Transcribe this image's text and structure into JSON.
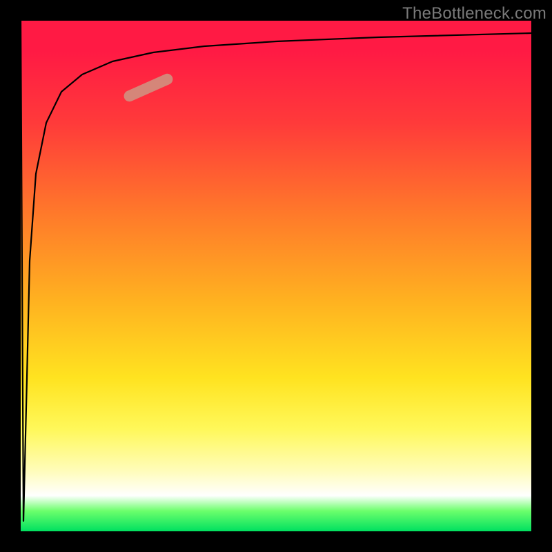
{
  "watermark": "TheBottleneck.com",
  "chart_data": {
    "type": "line",
    "title": "",
    "xlabel": "",
    "ylabel": "",
    "xlim": [
      0,
      1
    ],
    "ylim": [
      0,
      1
    ],
    "series": [
      {
        "name": "curve",
        "x": [
          0.0,
          0.006,
          0.012,
          0.018,
          0.03,
          0.05,
          0.08,
          0.12,
          0.18,
          0.26,
          0.36,
          0.5,
          0.7,
          1.0
        ],
        "y": [
          1.0,
          0.02,
          0.3,
          0.53,
          0.7,
          0.8,
          0.86,
          0.895,
          0.92,
          0.938,
          0.95,
          0.96,
          0.968,
          0.975
        ]
      }
    ],
    "highlight": {
      "x_range": [
        0.2,
        0.3
      ],
      "y_range": [
        0.82,
        0.87
      ],
      "color": "#d09080"
    }
  }
}
